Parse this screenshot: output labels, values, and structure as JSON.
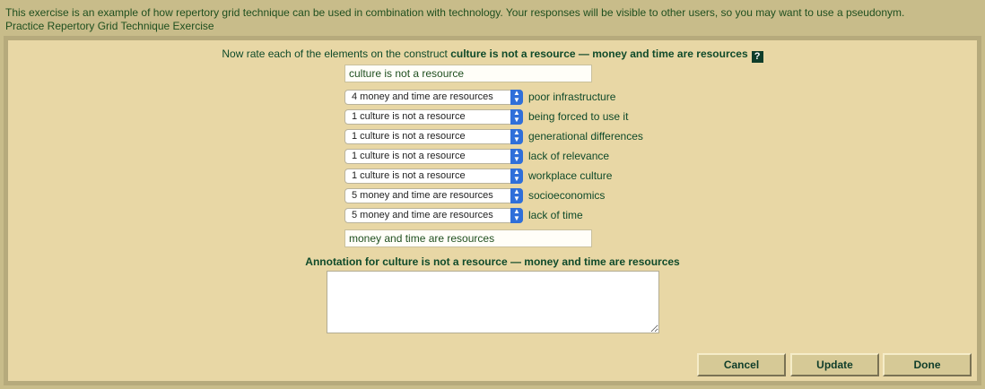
{
  "intro": {
    "notice": "This exercise is an example of how repertory grid technique can be used in combination with technology. Your responses will be visible to other users, so you may want to use a pseudonym.",
    "title": "Practice Repertory Grid Technique Exercise"
  },
  "prompt": {
    "prefix": "Now rate each of the elements on the construct",
    "construct": "culture is not a resource — money and time are resources",
    "help_icon": "?"
  },
  "left_pole": "culture is not a resource",
  "right_pole": "money and time are resources",
  "ratings": [
    {
      "selected": "4 money and time are resources",
      "element": "poor infrastructure"
    },
    {
      "selected": "1 culture is not a resource",
      "element": "being forced to use it"
    },
    {
      "selected": "1 culture is not a resource",
      "element": "generational differences"
    },
    {
      "selected": "1 culture is not a resource",
      "element": "lack of relevance"
    },
    {
      "selected": "1 culture is not a resource",
      "element": "workplace culture"
    },
    {
      "selected": "5 money and time are resources",
      "element": "socioeconomics"
    },
    {
      "selected": "5 money and time are resources",
      "element": "lack of time"
    }
  ],
  "annotation": {
    "label": "Annotation for culture is not a resource — money and time are resources",
    "value": ""
  },
  "buttons": {
    "cancel": "Cancel",
    "update": "Update",
    "done": "Done"
  },
  "icons": {
    "help": "help-icon",
    "dropdown": "chevron-updown-icon"
  },
  "colors": {
    "page_bg": "#c8bc8a",
    "panel_bg": "#e8d7a5",
    "text": "#0f4a2a",
    "select_accent": "#2f6fd9"
  }
}
